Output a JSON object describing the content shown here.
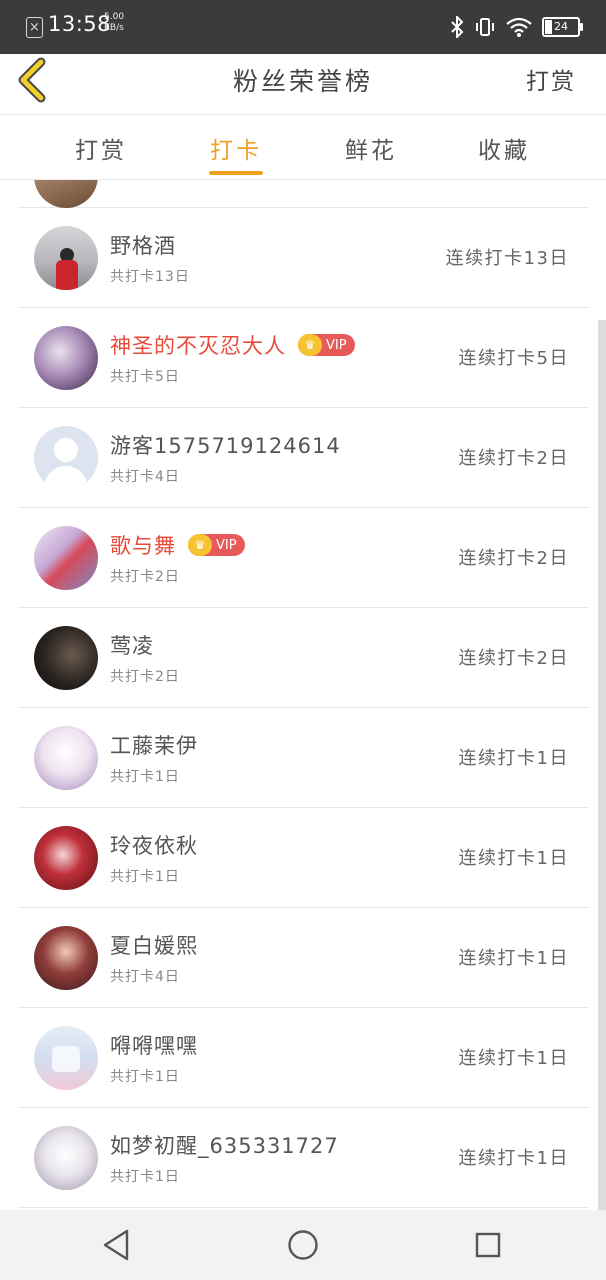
{
  "status_bar": {
    "time": "13:58",
    "speed_value": "5.00",
    "speed_unit": "KB/s",
    "battery": "24",
    "icons": [
      "x-notification-icon",
      "bluetooth-icon",
      "vibrate-icon",
      "wifi-icon",
      "battery-icon"
    ]
  },
  "header": {
    "title": "粉丝荣誉榜",
    "action": "打赏",
    "back_icon": "chevron-left-icon",
    "accent_color": "#f0a020"
  },
  "tabs": [
    {
      "label": "打赏",
      "active": false
    },
    {
      "label": "打卡",
      "active": true
    },
    {
      "label": "鲜花",
      "active": false
    },
    {
      "label": "收藏",
      "active": false
    }
  ],
  "list": [
    {
      "name": "野格酒",
      "vip": false,
      "sub": "共打卡13日",
      "streak": "连续打卡13日"
    },
    {
      "name": "神圣的不灭忍大人",
      "vip": true,
      "vip_label": "VIP",
      "sub": "共打卡5日",
      "streak": "连续打卡5日"
    },
    {
      "name": "游客1575719124614",
      "vip": false,
      "sub": "共打卡4日",
      "streak": "连续打卡2日"
    },
    {
      "name": "歌与舞",
      "vip": true,
      "vip_label": "VIP",
      "sub": "共打卡2日",
      "streak": "连续打卡2日"
    },
    {
      "name": "莺凌",
      "vip": false,
      "sub": "共打卡2日",
      "streak": "连续打卡2日"
    },
    {
      "name": "工藤茉伊",
      "vip": false,
      "sub": "共打卡1日",
      "streak": "连续打卡1日"
    },
    {
      "name": "玲夜依秋",
      "vip": false,
      "sub": "共打卡1日",
      "streak": "连续打卡1日"
    },
    {
      "name": "夏白媛熙",
      "vip": false,
      "sub": "共打卡4日",
      "streak": "连续打卡1日"
    },
    {
      "name": "嘚嘚嘿嘿",
      "vip": false,
      "sub": "共打卡1日",
      "streak": "连续打卡1日"
    },
    {
      "name": "如梦初醒_635331727",
      "vip": false,
      "sub": "共打卡1日",
      "streak": "连续打卡1日"
    }
  ],
  "system_nav": [
    "back-triangle-icon",
    "home-circle-icon",
    "recents-square-icon"
  ]
}
